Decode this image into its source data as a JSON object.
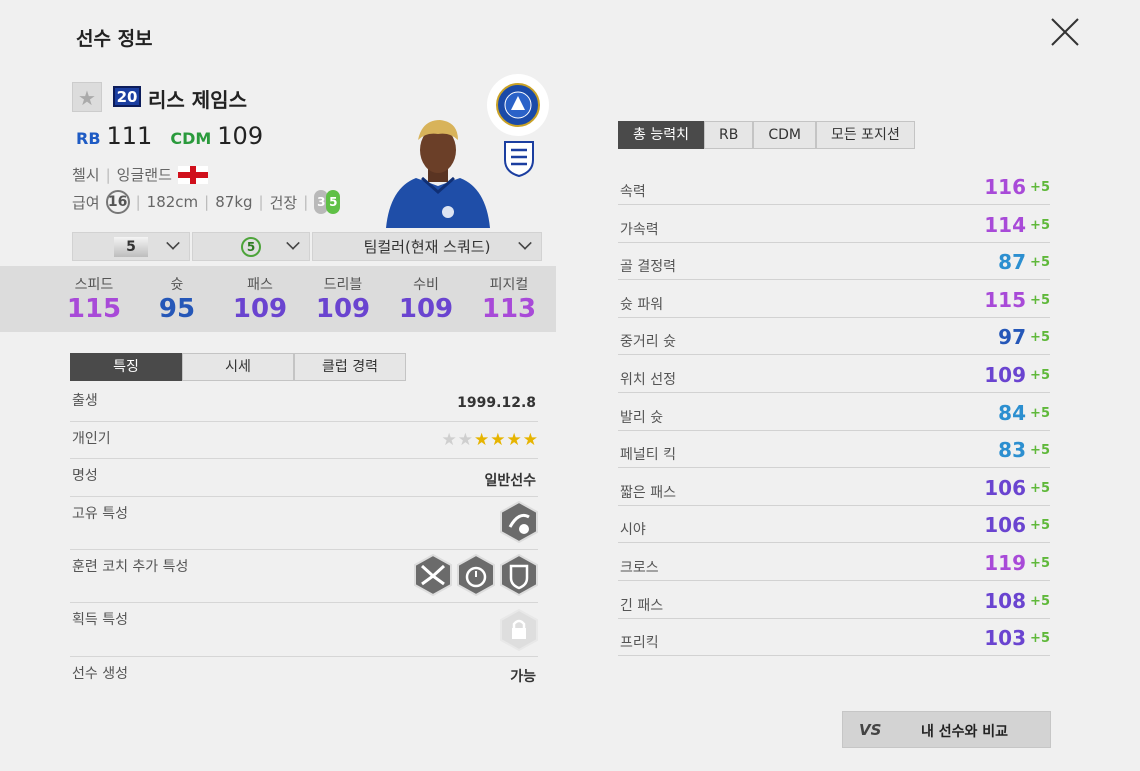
{
  "page_title": "선수 정보",
  "player": {
    "season_no": "20",
    "name": "리스 제임스",
    "positions": [
      {
        "pos": "RB",
        "ovr": "111"
      },
      {
        "pos": "CDM",
        "ovr": "109"
      }
    ],
    "club": "첼시",
    "nation": "잉글랜드",
    "salary_label": "급여",
    "salary": "16",
    "height": "182cm",
    "weight": "87kg",
    "health_label": "건장",
    "condition_values": [
      "3",
      "5"
    ]
  },
  "selectors": {
    "enhance": "5",
    "grade": "5",
    "team_color": "팀컬러(현재 스쿼드)"
  },
  "summary_stats": [
    {
      "label": "스피드",
      "value": "115",
      "color": "#a84ad8"
    },
    {
      "label": "슛",
      "value": "95",
      "color": "#2557b8"
    },
    {
      "label": "패스",
      "value": "109",
      "color": "#6a44d0"
    },
    {
      "label": "드리블",
      "value": "109",
      "color": "#6a44d0"
    },
    {
      "label": "수비",
      "value": "109",
      "color": "#6a44d0"
    },
    {
      "label": "피지컬",
      "value": "113",
      "color": "#a84ad8"
    }
  ],
  "tabs": [
    "특징",
    "시세",
    "클럽 경력"
  ],
  "details": {
    "birth_label": "출생",
    "birth": "1999.12.8",
    "popularity_label": "개인기",
    "popularity_stars": 4,
    "popularity_max": 6,
    "fame_label": "명성",
    "fame": "일반선수",
    "unique_trait_label": "고유 특성",
    "coach_trait_label": "훈련 코치 추가 특성",
    "acquired_trait_label": "획득 특성",
    "creation_label": "선수 생성",
    "creation": "가능"
  },
  "right_tabs": [
    "총 능력치",
    "RB",
    "CDM",
    "모든 포지션"
  ],
  "attributes": [
    {
      "name": "속력",
      "value": "116",
      "bonus": "+5",
      "color": "#a84ad8"
    },
    {
      "name": "가속력",
      "value": "114",
      "bonus": "+5",
      "color": "#a84ad8"
    },
    {
      "name": "골 결정력",
      "value": "87",
      "bonus": "+5",
      "color": "#2c8fd0"
    },
    {
      "name": "슛 파워",
      "value": "115",
      "bonus": "+5",
      "color": "#a84ad8"
    },
    {
      "name": "중거리 슛",
      "value": "97",
      "bonus": "+5",
      "color": "#2557b8"
    },
    {
      "name": "위치 선정",
      "value": "109",
      "bonus": "+5",
      "color": "#6a44d0"
    },
    {
      "name": "발리 슛",
      "value": "84",
      "bonus": "+5",
      "color": "#2c8fd0"
    },
    {
      "name": "페널티 킥",
      "value": "83",
      "bonus": "+5",
      "color": "#2c8fd0"
    },
    {
      "name": "짧은 패스",
      "value": "106",
      "bonus": "+5",
      "color": "#6a44d0"
    },
    {
      "name": "시야",
      "value": "106",
      "bonus": "+5",
      "color": "#6a44d0"
    },
    {
      "name": "크로스",
      "value": "119",
      "bonus": "+5",
      "color": "#a84ad8"
    },
    {
      "name": "긴 패스",
      "value": "108",
      "bonus": "+5",
      "color": "#6a44d0"
    },
    {
      "name": "프리킥",
      "value": "103",
      "bonus": "+5",
      "color": "#6a44d0"
    }
  ],
  "compare_button": {
    "vs": "VS",
    "label": "내 선수와 비교"
  }
}
